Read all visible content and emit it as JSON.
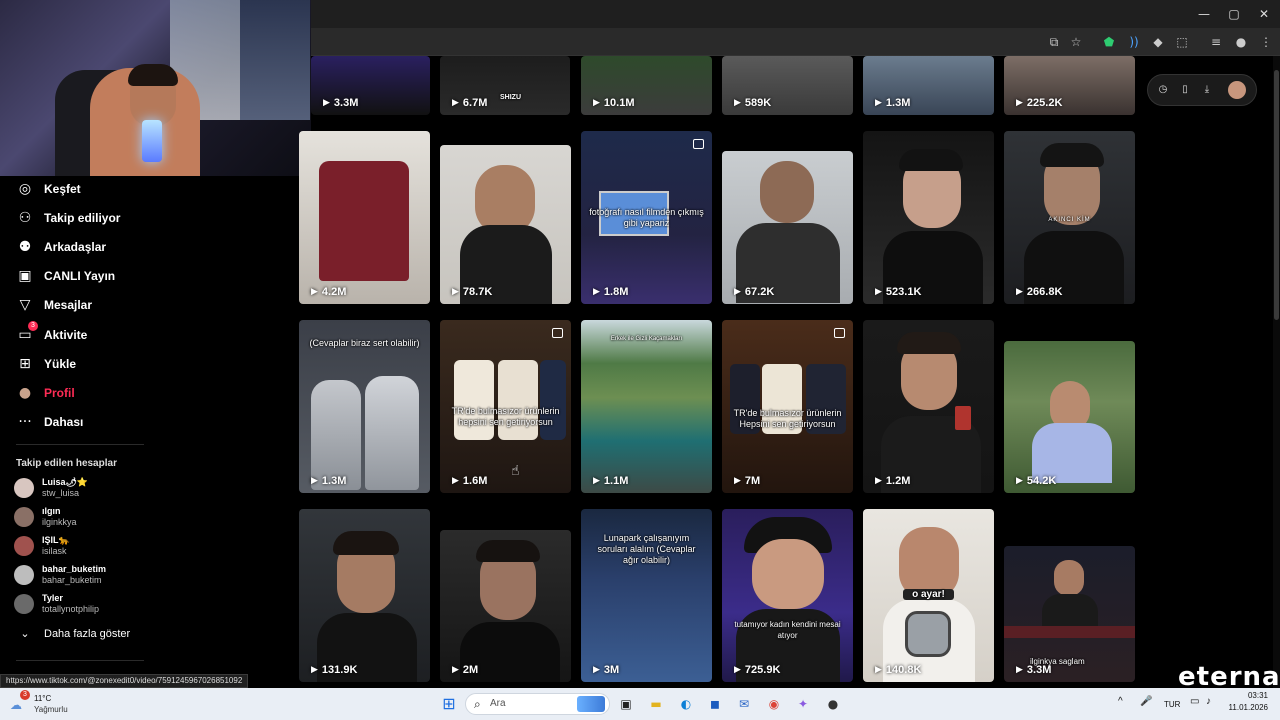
{
  "window": {
    "minimize": "—",
    "restore": "▢",
    "close": "✕"
  },
  "sidebar": {
    "items": [
      {
        "icon": "compass-icon",
        "glyph": "◎",
        "label": "Keşfet"
      },
      {
        "icon": "following-icon",
        "glyph": "⚇",
        "label": "Takip ediliyor"
      },
      {
        "icon": "friends-icon",
        "glyph": "⚉",
        "label": "Arkadaşlar"
      },
      {
        "icon": "live-icon",
        "glyph": "▣",
        "label": "CANLI Yayın"
      },
      {
        "icon": "messages-icon",
        "glyph": "▽",
        "label": "Mesajlar"
      },
      {
        "icon": "activity-icon",
        "glyph": "▭",
        "label": "Aktivite",
        "badge": "3"
      },
      {
        "icon": "upload-icon",
        "glyph": "⊞",
        "label": "Yükle"
      },
      {
        "icon": "profile-avatar",
        "glyph": "●",
        "label": "Profil"
      },
      {
        "icon": "more-icon",
        "glyph": "···",
        "label": "Dahası"
      }
    ],
    "following_title": "Takip edilen hesaplar",
    "accounts": [
      {
        "name": "Luisa🌶⭐",
        "handle": "stw_luisa"
      },
      {
        "name": "ılgın",
        "handle": "ilginkkya"
      },
      {
        "name": "IŞIL🐆",
        "handle": "isilask"
      },
      {
        "name": "bahar_buketim",
        "handle": "bahar_buketim"
      },
      {
        "name": "Tyler",
        "handle": "totallynotphilip"
      }
    ],
    "show_more": "Daha fazla göster"
  },
  "videos": {
    "row1": [
      "3.3M",
      "6.7M",
      "10.1M",
      "589K",
      "1.3M",
      "225.2K"
    ],
    "row2": [
      "4.2M",
      "78.7K",
      "1.8M",
      "67.2K",
      "523.1K",
      "266.8K"
    ],
    "row3": [
      "1.3M",
      "1.6M",
      "1.1M",
      "7M",
      "1.2M",
      "54.2K"
    ],
    "row4": [
      "131.9K",
      "2M",
      "3M",
      "725.9K",
      "140.8K",
      "3.3M"
    ]
  },
  "captions": {
    "r2c3": "fotoğrafı nasıl filmden çıkmış gibi yapariz",
    "r2c6": "AKINCI KİM",
    "r3c1_top": "(Cevaplar biraz sert olabilir)",
    "r3c2": "TR'de bulmasızor ürünlerin hepsini sen getiriyorsun",
    "r3c3": "Erkek ile Gizli Kaçamakları",
    "r3c4": "TR'de bulmasızor ürünlerin Hepsini sen getiriyorsun",
    "r4c3": "Lunapark çalışanıyım soruları alalım (Cevaplar ağır olabilir)",
    "r4c4": "tutamıyor kadın kendini mesai atıyor",
    "r4c5": "o ayar!",
    "r4c6": "ilginkya saglam",
    "r1c2": "SHIZU"
  },
  "status_url": "https://www.tiktok.com/@zonexedit0/video/7591245967026851092",
  "watermark": "eternal",
  "taskbar": {
    "weather_temp": "11°C",
    "weather_desc": "Yağmurlu",
    "weather_badge": "3",
    "search_placeholder": "Ara",
    "lang": "TUR",
    "time": "03:31",
    "date": "11.01.2026"
  }
}
